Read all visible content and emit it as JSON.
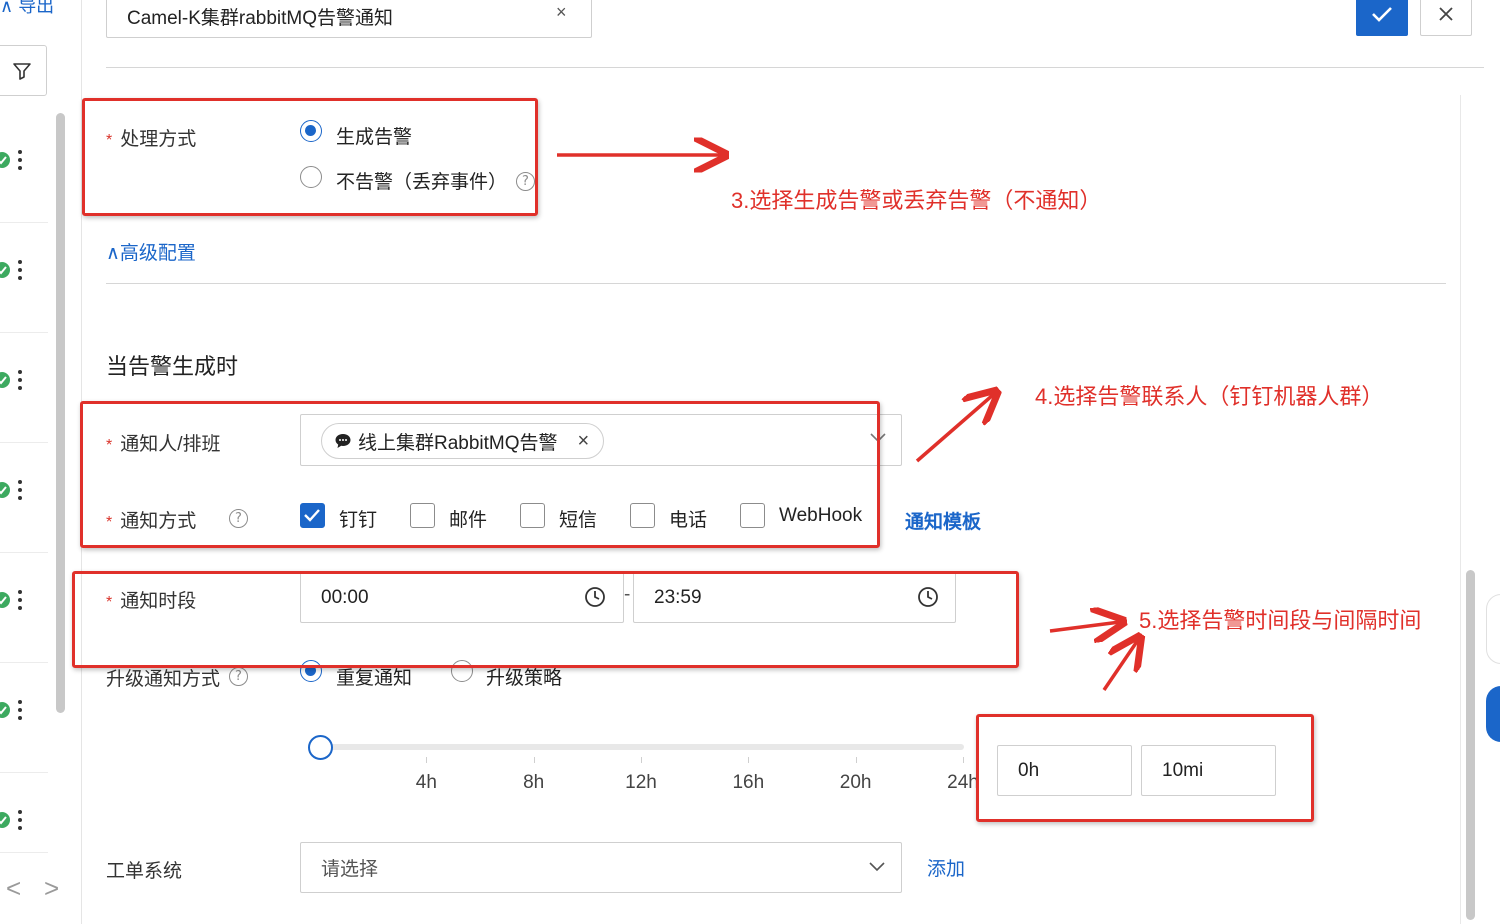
{
  "left_panel": {
    "export_label": "导出",
    "filter_icon": "filter-icon",
    "row_status_icon": "check-circle-icon",
    "row_menu_icon": "more-vertical-icon",
    "pager_prev": "<",
    "pager_next": ">"
  },
  "header": {
    "title_value": "Camel-K集群rabbitMQ告警通知",
    "clear_symbol": "×"
  },
  "form": {
    "handling": {
      "label": "处理方式",
      "options": [
        "生成告警",
        "不告警（丢弃事件）"
      ],
      "selected": "生成告警"
    },
    "advanced_config": "高级配置",
    "section_title": "当告警生成时",
    "notify_person": {
      "label": "通知人/排班",
      "tag": "线上集群RabbitMQ告警",
      "tag_close": "×"
    },
    "notify_method": {
      "label": "通知方式",
      "options": [
        "钉钉",
        "邮件",
        "短信",
        "电话",
        "WebHook"
      ],
      "checked": [
        "钉钉"
      ],
      "template_link": "通知模板"
    },
    "notify_period": {
      "label": "通知时段",
      "start": "00:00",
      "separator": "-",
      "end": "23:59"
    },
    "upgrade": {
      "label": "升级通知方式",
      "options": [
        "重复通知",
        "升级策略"
      ],
      "selected": "重复通知"
    },
    "interval": {
      "slider_level_hours": 0,
      "ticks": [
        "4h",
        "8h",
        "12h",
        "16h",
        "20h",
        "24h"
      ],
      "hours_value": "0h",
      "minutes_value": "10mi"
    },
    "ticket_system": {
      "label": "工单系统",
      "placeholder": "请选择",
      "add_link": "添加"
    }
  },
  "annotations": {
    "step3": "3.选择生成告警或丢弃告警（不通知）",
    "step4": "4.选择告警联系人（钉钉机器人群）",
    "step5": "5.选择告警时间段与间隔时间"
  },
  "colors": {
    "primary": "#1b66c9",
    "annotation_red": "#e0302a",
    "status_green": "#3daa60"
  }
}
